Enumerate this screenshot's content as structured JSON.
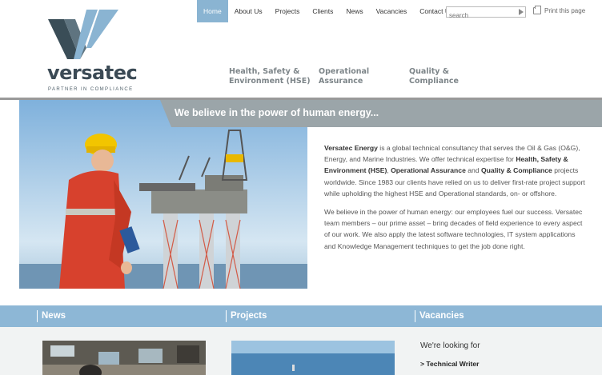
{
  "brand": {
    "name": "versatec",
    "tagline": "PARTNER IN COMPLIANCE",
    "colors": {
      "dark": "#3a4d57",
      "light": "#8ab4d2"
    }
  },
  "topnav": {
    "items": [
      {
        "label": "Home",
        "active": true
      },
      {
        "label": "About Us",
        "active": false
      },
      {
        "label": "Projects",
        "active": false
      },
      {
        "label": "Clients",
        "active": false
      },
      {
        "label": "News",
        "active": false
      },
      {
        "label": "Vacancies",
        "active": false
      },
      {
        "label": "Contact Us",
        "active": false
      }
    ]
  },
  "search": {
    "placeholder": "search",
    "value": "",
    "button_icon": "play-arrow-icon"
  },
  "print": {
    "label": "Print this page",
    "icon": "printer-icon"
  },
  "services": [
    {
      "line1": "Health, Safety &",
      "line2": "Environment (HSE)"
    },
    {
      "line1": "Operational",
      "line2": "Assurance"
    },
    {
      "line1": "Quality &",
      "line2": "Compliance"
    }
  ],
  "hero": {
    "banner": "We believe in the power of human energy...",
    "p1": {
      "brand": "Versatec Energy",
      "t1": " is a global technical consultancy that serves the Oil & Gas (O&G), Energy, and Marine Industries. We offer technical expertise for ",
      "s1": "Health, Safety & Environment (HSE)",
      "t2": ", ",
      "s2": "Operational Assurance",
      "t3": " and ",
      "s3": "Quality & Compliance",
      "t4": " projects worldwide. Since 1983 our clients have relied on us to deliver first-rate project support while upholding the highest HSE and Operational standards, on- or offshore."
    },
    "p2": "We believe in the power of human energy: our employees fuel our success. Versatec team members – our prime asset – bring decades of field experience to every aspect of our work. We also apply the latest software technologies, IT system applications and Knowledge Management techniques to get the job done right."
  },
  "columns": {
    "news": "News",
    "projects": "Projects",
    "vacancies": "Vacancies"
  },
  "vacancies": {
    "heading": "We're looking for",
    "link": "> Technical Writer"
  }
}
